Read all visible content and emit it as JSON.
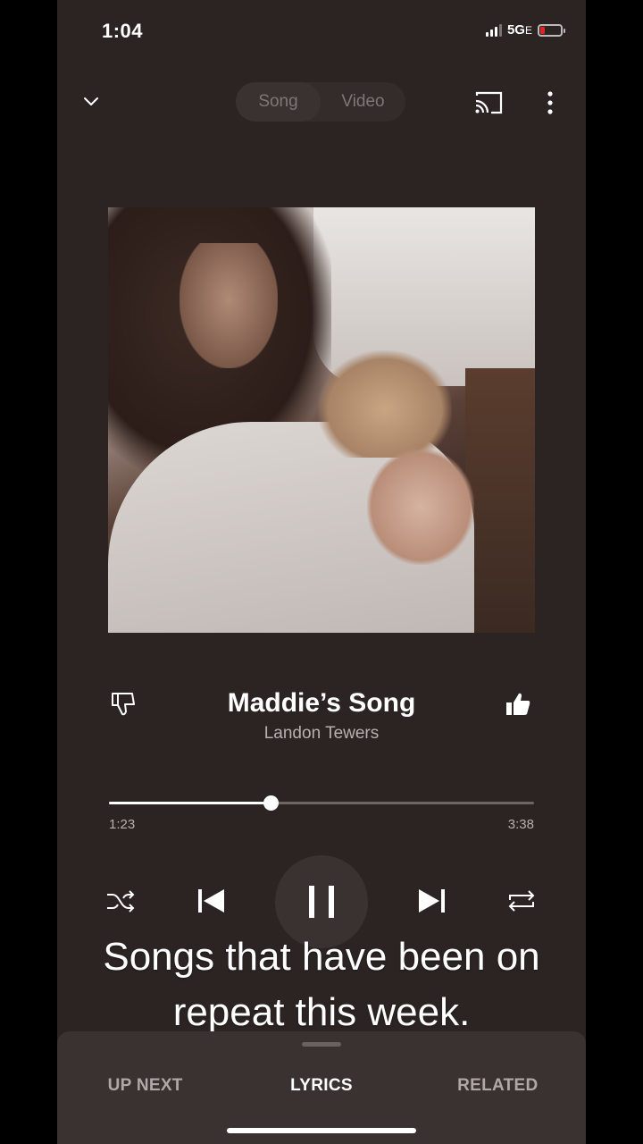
{
  "status_bar": {
    "time": "1:04",
    "network": "5G",
    "network_suffix": "E"
  },
  "top_bar": {
    "tabs": [
      {
        "label": "Song",
        "active": true
      },
      {
        "label": "Video",
        "active": false
      }
    ],
    "icons": [
      "chevron-down-icon",
      "cast-icon",
      "more-vertical-icon"
    ]
  },
  "song": {
    "title": "Maddie’s Song",
    "artist": "Landon Tewers"
  },
  "playback": {
    "current": "1:23",
    "total": "3:38",
    "progress": 0.381,
    "state": "playing"
  },
  "controls": [
    "shuffle-icon",
    "previous-icon",
    "pause-icon",
    "next-icon",
    "repeat-icon"
  ],
  "caption": {
    "line1": "Songs that have been on",
    "line2": "repeat this week."
  },
  "bottom_tabs": [
    {
      "label": "UP NEXT"
    },
    {
      "label": "LYRICS"
    },
    {
      "label": "RELATED"
    }
  ],
  "colors": {
    "background": "#2b2423",
    "sheet": "#3a3231",
    "battery_low": "#e02424"
  }
}
